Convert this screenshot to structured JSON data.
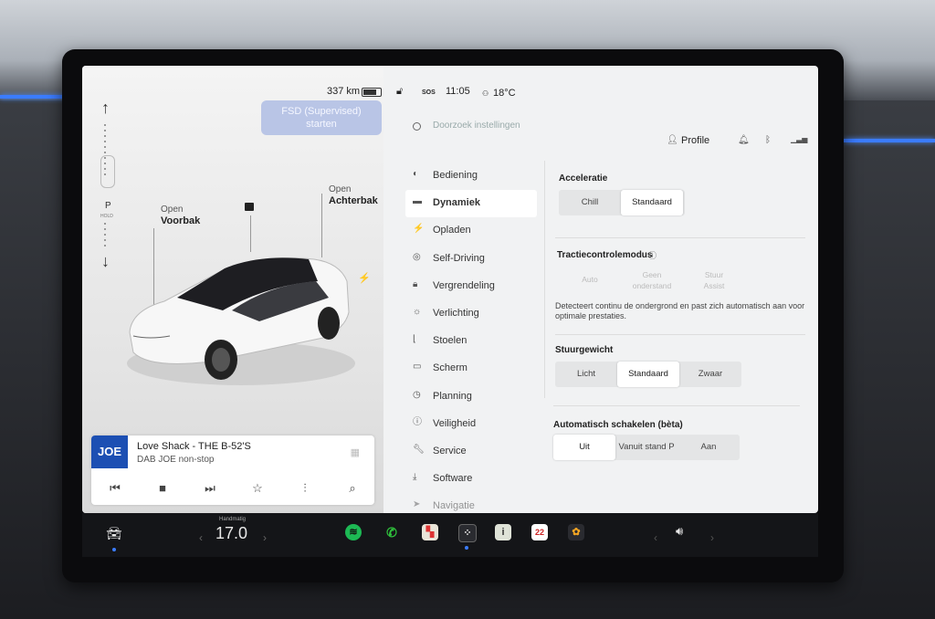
{
  "status": {
    "range": "337 km",
    "sos": "SOS",
    "time": "11:05",
    "temperature": "18°C"
  },
  "fsd_button": {
    "line1": "FSD (Supervised)",
    "line2": "starten"
  },
  "car_view": {
    "gear_up": "↑",
    "gear": "P",
    "gear_hold": "HOLD",
    "gear_down": "↓",
    "front_trunk_small": "Open",
    "front_trunk": "Voorbak",
    "rear_trunk_small": "Open",
    "rear_trunk": "Achterbak"
  },
  "media": {
    "station_logo": "JOE",
    "song": "Love Shack - THE B-52'S",
    "station": "DAB JOE non-stop"
  },
  "search": {
    "placeholder": "Doorzoek instellingen"
  },
  "header": {
    "profile": "Profile"
  },
  "nav": [
    {
      "label": "Bediening",
      "icon": "toggle-icon"
    },
    {
      "label": "Dynamiek",
      "icon": "car-icon",
      "active": true
    },
    {
      "label": "Opladen",
      "icon": "bolt-icon"
    },
    {
      "label": "Self-Driving",
      "icon": "steering-wheel-icon"
    },
    {
      "label": "Vergrendeling",
      "icon": "lock-icon"
    },
    {
      "label": "Verlichting",
      "icon": "light-icon"
    },
    {
      "label": "Stoelen",
      "icon": "seat-icon"
    },
    {
      "label": "Scherm",
      "icon": "screen-icon"
    },
    {
      "label": "Planning",
      "icon": "clock-icon"
    },
    {
      "label": "Veiligheid",
      "icon": "alert-icon"
    },
    {
      "label": "Service",
      "icon": "wrench-icon"
    },
    {
      "label": "Software",
      "icon": "download-icon"
    },
    {
      "label": "Navigatie",
      "icon": "navigation-icon"
    }
  ],
  "acceleration": {
    "title": "Acceleratie",
    "options": [
      "Chill",
      "Standaard"
    ],
    "selected": "Standaard"
  },
  "traction": {
    "title": "Tractiecontrolemodus",
    "options": [
      [
        "Auto"
      ],
      [
        "Geen",
        "onderstand"
      ],
      [
        "Stuur",
        "Assist"
      ]
    ],
    "description": "Detecteert continu de ondergrond en past zich automatisch aan voor optimale prestaties."
  },
  "steering": {
    "title": "Stuurgewicht",
    "options": [
      "Licht",
      "Standaard",
      "Zwaar"
    ],
    "selected": "Standaard"
  },
  "auto_shift": {
    "title": "Automatisch schakelen (bèta)",
    "options": [
      "Uit",
      "Vanuit stand P",
      "Aan"
    ],
    "selected": "Uit"
  },
  "taskbar": {
    "climate_mode": "Handmatig",
    "temperature": "17.0",
    "calendar_day": "22"
  },
  "colors": {
    "accent": "#3b7cff",
    "fsd_button": "#b9c5e6",
    "joe_brand": "#1c4fb3",
    "spotify": "#1db954",
    "phone": "#2fc13c"
  }
}
